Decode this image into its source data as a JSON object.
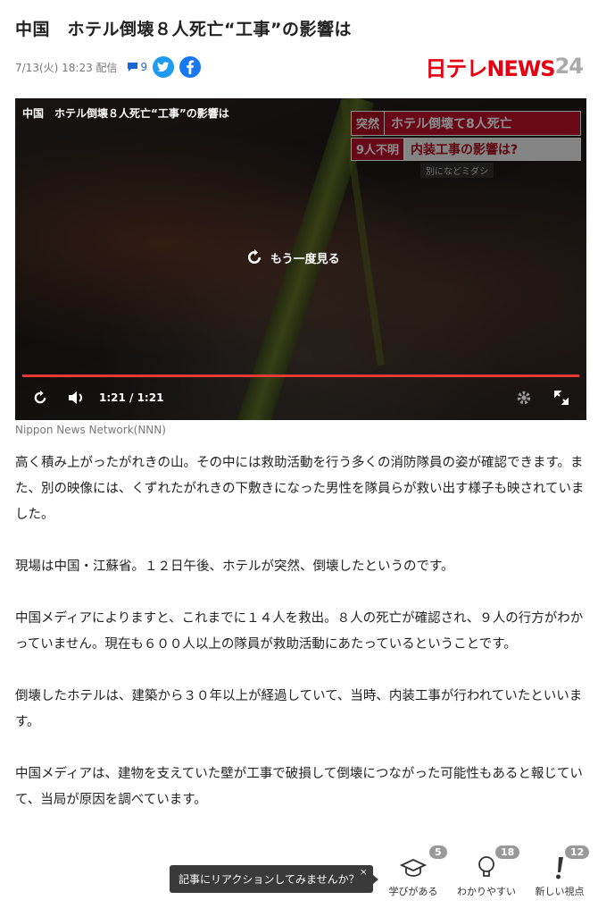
{
  "article": {
    "title": "中国　ホテル倒壊８人死亡“工事”の影響は",
    "date": "7/13(火) 18:23 配信",
    "comment_count": "9"
  },
  "brand": {
    "logo_main": "日テレNEWS",
    "logo_num": "24"
  },
  "video": {
    "title": "中国　ホテル倒壊８人死亡“工事”の影響は",
    "replay_label": "もう一度見る",
    "time": "1:21 / 1:21",
    "progress": 1.0,
    "ticker": {
      "tag": "突然",
      "headline": "ホテル倒壊て8人死亡",
      "sub1": "9人不明",
      "sub2": "内装工事の影響は?",
      "sub3": "別になどミダシ"
    }
  },
  "credit": "Nippon News Network(NNN)",
  "paragraphs": [
    "高く積み上がったがれきの山。その中には救助活動を行う多くの消防隊員の姿が確認できます。また、別の映像には、くずれたがれきの下敷きになった男性を隊員らが救い出す様子も映されていました。",
    "現場は中国・江蘇省。１２日午後、ホテルが突然、倒壊したというのです。",
    "中国メディアによりますと、これまでに１４人を救出。８人の死亡が確認され、９人の行方がわかっていません。現在も６００人以上の隊員が救助活動にあたっているということです。",
    "倒壊したホテルは、建築から３０年以上が経過していて、当時、内装工事が行われていたといいます。",
    "中国メディアは、建物を支えていた壁が工事で破損して倒壊につながった可能性もあると報じていて、当局が原因を調べています。"
  ],
  "reactions": {
    "prompt": "記事にリアクションしてみませんか？",
    "close": "×",
    "items": [
      {
        "icon": "graduation-cap-icon",
        "label": "学びがある",
        "count": "5"
      },
      {
        "icon": "lightbulb-icon",
        "label": "わかりやすい",
        "count": "18"
      },
      {
        "icon": "exclamation-icon",
        "label": "新しい視点",
        "count": "12"
      }
    ]
  }
}
